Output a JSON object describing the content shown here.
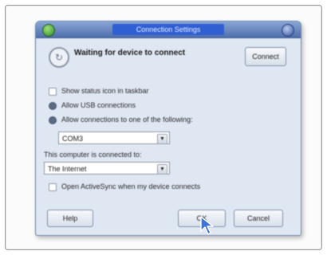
{
  "window": {
    "title": "Connection Settings"
  },
  "status": {
    "message": "Waiting for device to connect",
    "connect_label": "Connect"
  },
  "options": {
    "show_status_icon": "Show status icon in taskbar",
    "allow_usb": "Allow USB connections",
    "allow_one_of": "Allow connections to one of the following:",
    "port_value": "COM3",
    "computer_connected_to_label": "This computer is connected to:",
    "network_value": "The Internet",
    "open_when_connects": "Open ActiveSync when my device connects"
  },
  "buttons": {
    "help": "Help",
    "ok": "OK",
    "cancel": "Cancel"
  }
}
